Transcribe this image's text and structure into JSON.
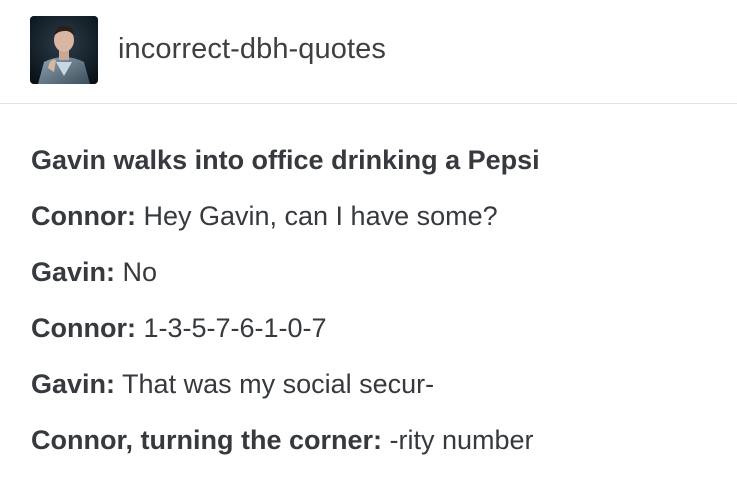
{
  "header": {
    "blog_name": "incorrect-dbh-quotes",
    "avatar_icon": "blog-avatar-portrait"
  },
  "post": {
    "lines": [
      {
        "speaker": "Gavin walks into office drinking a Pepsi",
        "text": ""
      },
      {
        "speaker": "Connor:",
        "text": " Hey Gavin, can I have some?"
      },
      {
        "speaker": "Gavin:",
        "text": " No"
      },
      {
        "speaker": "Connor:",
        "text": " 1-3-5-7-6-1-0-7"
      },
      {
        "speaker": "Gavin:",
        "text": " That was my social secur-"
      },
      {
        "speaker": "Connor, turning the corner:",
        "text": " -rity number"
      }
    ]
  },
  "colors": {
    "text": "#36393d",
    "divider": "#e3e3e3",
    "background": "#ffffff"
  }
}
